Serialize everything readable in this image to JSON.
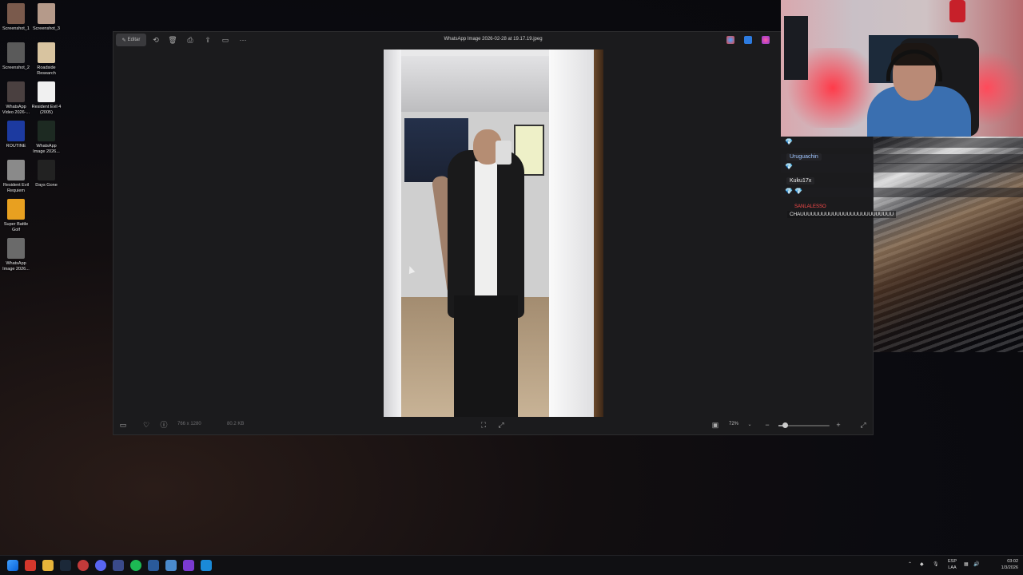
{
  "desktop": {
    "icons": [
      {
        "label": "Screenshot_1",
        "color": "#7a5a4c"
      },
      {
        "label": "Screenshot_3",
        "color": "#b59a8a"
      },
      {
        "label": "Screenshot_2",
        "color": "#5a5a5a"
      },
      {
        "label": "Roadside Research",
        "color": "#d8c4a0"
      },
      {
        "label": "WhatsApp Video 2026-...",
        "color": "#4a4040"
      },
      {
        "label": "Resident Evil 4 (2005)",
        "color": "#f0f0f0"
      },
      {
        "label": "ROUTINE",
        "color": "#1c3aa0"
      },
      {
        "label": "WhatsApp Image 2026...",
        "color": "#1d2a22"
      },
      {
        "label": "Resident Evil Requiem",
        "color": "#8a8a8a"
      },
      {
        "label": "Days Gone",
        "color": "#222222"
      },
      {
        "label": "Super Battle Golf",
        "color": "#e8a020"
      },
      {
        "label": "WhatsApp Image 2026...",
        "color": "#6a6a6a"
      }
    ]
  },
  "photo_window": {
    "title": "WhatsApp Image 2026-02-28 at 19.17.19.jpeg",
    "edit_label": "Editar",
    "toolbar_icons": [
      "rotate-icon",
      "delete-icon",
      "print-icon",
      "share-icon",
      "slideshow-icon",
      "more-icon"
    ],
    "dimensions": "766 x 1280",
    "file_size": "80.2 KB",
    "zoom": "72%",
    "zoom_level": 0.12
  },
  "chat": {
    "messages": [
      {
        "user": "",
        "text": "",
        "emote": "💎"
      },
      {
        "user": "Uruguachin",
        "text": "",
        "emote": "💎"
      },
      {
        "user": "Kuku17x",
        "text": "",
        "emote": "💎 💎"
      },
      {
        "user": "SANLALESSO",
        "text": "CHAUUUUUUUUUUUUUUUUUUUUUUUUUU"
      }
    ]
  },
  "taskbar": {
    "language": "ESP\nLAA",
    "time": "03:02",
    "date": "1/3/2026"
  }
}
